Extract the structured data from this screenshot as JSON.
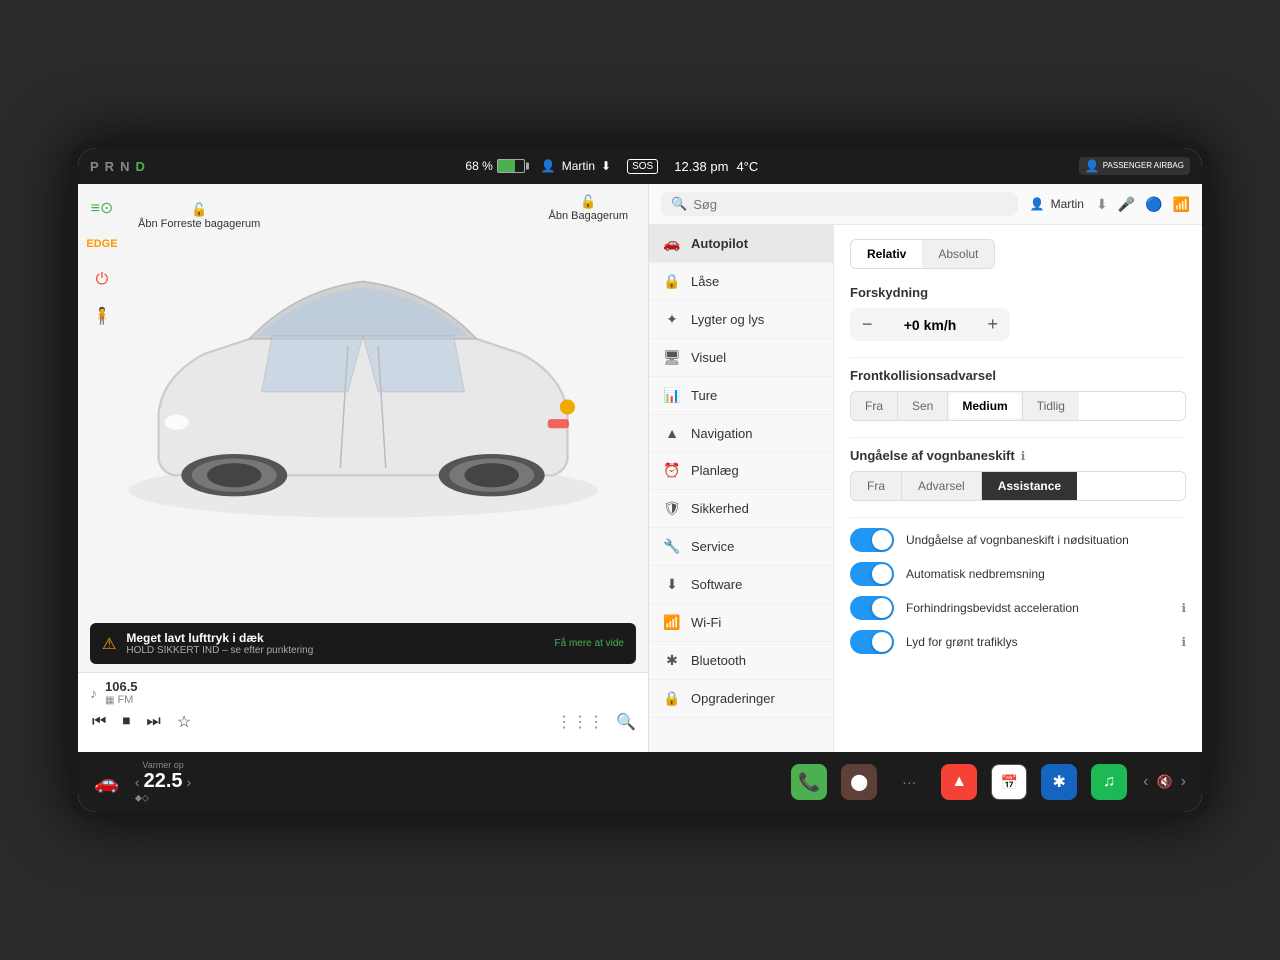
{
  "statusBar": {
    "prnd": [
      "P",
      "R",
      "N",
      "D"
    ],
    "battery": "68 %",
    "userName": "Martin",
    "sosLabel": "SOS",
    "time": "12.38 pm",
    "temperature": "4°C",
    "passengerLabel": "PASSENGER AIRBAG"
  },
  "leftPanel": {
    "doorLabels": {
      "frontTrunk": "Åbn\nForreste\nbagagerum",
      "rearTrunk": "Åbn\nBagagerum"
    },
    "alert": {
      "title": "Meget lavt lufttryk i dæk",
      "subtitle": "HOLD SIKKERT IND – se efter punktering",
      "link": "Få mere at vide"
    }
  },
  "mediaPlayer": {
    "station": "106.5",
    "type": "FM"
  },
  "bottomBar": {
    "climateLabel": "Varmer op",
    "temperature": "22.5",
    "appIcons": [
      "📞",
      "📷",
      "···",
      "🗺",
      "📅",
      "🔵",
      "🎵"
    ]
  },
  "rightPanel": {
    "search": {
      "placeholder": "Søg"
    },
    "header": {
      "userName": "Martin"
    },
    "menu": [
      {
        "icon": "🚗",
        "label": "Autopilot",
        "active": true
      },
      {
        "icon": "🔒",
        "label": "Låse"
      },
      {
        "icon": "💡",
        "label": "Lygter og lys"
      },
      {
        "icon": "🖥",
        "label": "Visuel"
      },
      {
        "icon": "📊",
        "label": "Ture"
      },
      {
        "icon": "🧭",
        "label": "Navigation"
      },
      {
        "icon": "⏰",
        "label": "Planlæg"
      },
      {
        "icon": "🛡",
        "label": "Sikkerhed"
      },
      {
        "icon": "🔧",
        "label": "Service"
      },
      {
        "icon": "⬇",
        "label": "Software"
      },
      {
        "icon": "📶",
        "label": "Wi-Fi"
      },
      {
        "icon": "🔵",
        "label": "Bluetooth"
      },
      {
        "icon": "🔒",
        "label": "Opgraderinger"
      }
    ],
    "autopilot": {
      "speedLabel": "Forskydning",
      "speedValue": "+0 km/h",
      "relativeLabel": "Relativ",
      "absoluteLabel": "Absolut",
      "collisionLabel": "Frontkollisionsadvarsel",
      "collisionOptions": [
        "Fra",
        "Sen",
        "Medium",
        "Tidlig"
      ],
      "collisionActive": "Medium",
      "laneLabel": "Ungåelse af vognbaneskift",
      "laneOptions": [
        "Fra",
        "Advarsel",
        "Assistance"
      ],
      "laneActive": "Assistance",
      "toggles": [
        {
          "label": "Undgåelse af vognbaneskift i nødsituation",
          "state": true
        },
        {
          "label": "Automatisk nedbremsning",
          "state": true
        },
        {
          "label": "Forhindringsbevidst acceleration",
          "state": true,
          "info": true
        },
        {
          "label": "Lyd for grønt trafiklys",
          "state": true,
          "info": true
        }
      ]
    }
  }
}
